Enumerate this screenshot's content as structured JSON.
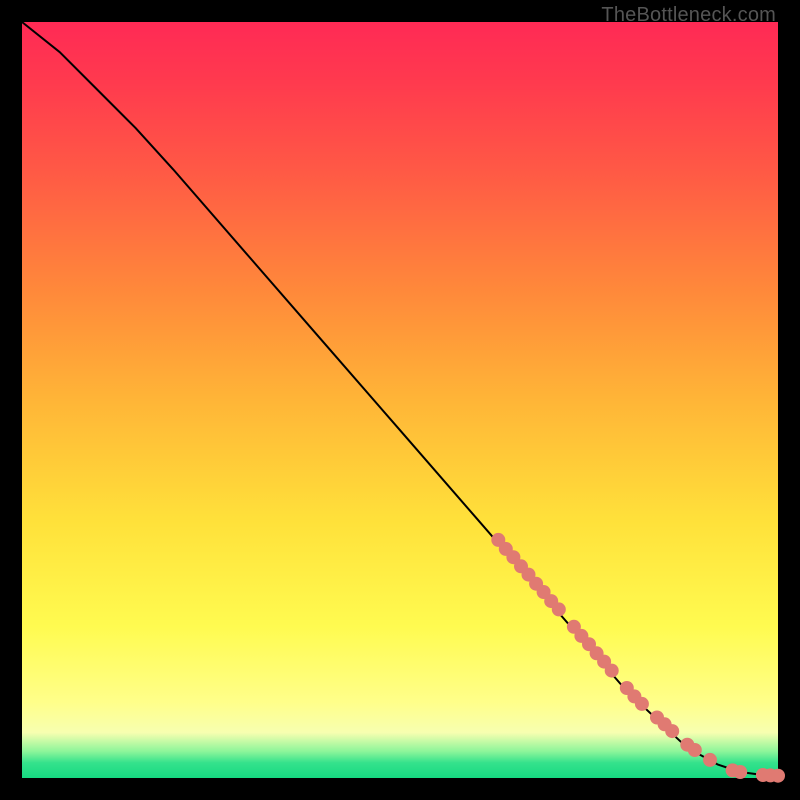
{
  "watermark": "TheBottleneck.com",
  "chart_data": {
    "type": "line",
    "title": "",
    "xlabel": "",
    "ylabel": "",
    "xlim": [
      0,
      100
    ],
    "ylim": [
      0,
      100
    ],
    "grid": false,
    "series": [
      {
        "name": "curve",
        "x": [
          0,
          5,
          10,
          15,
          20,
          30,
          40,
          50,
          60,
          70,
          80,
          88,
          92,
          95,
          98,
          100
        ],
        "y": [
          100,
          96,
          91,
          86,
          80.5,
          69,
          57.5,
          46,
          34.5,
          23,
          11.5,
          4,
          1.8,
          0.8,
          0.4,
          0.3
        ]
      }
    ],
    "marker_segments": {
      "name": "highlighted-points",
      "color": "#e07a72",
      "points": [
        [
          63,
          31.5
        ],
        [
          64,
          30.3
        ],
        [
          65,
          29.2
        ],
        [
          66,
          28.0
        ],
        [
          67,
          26.9
        ],
        [
          68,
          25.7
        ],
        [
          69,
          24.6
        ],
        [
          70,
          23.4
        ],
        [
          71,
          22.3
        ],
        [
          73,
          20.0
        ],
        [
          74,
          18.8
        ],
        [
          75,
          17.7
        ],
        [
          76,
          16.5
        ],
        [
          77,
          15.4
        ],
        [
          78,
          14.2
        ],
        [
          80,
          11.9
        ],
        [
          81,
          10.8
        ],
        [
          82,
          9.8
        ],
        [
          84,
          8.0
        ],
        [
          85,
          7.1
        ],
        [
          86,
          6.2
        ],
        [
          88,
          4.4
        ],
        [
          89,
          3.7
        ],
        [
          91,
          2.4
        ],
        [
          94,
          1.0
        ],
        [
          95,
          0.8
        ],
        [
          98,
          0.4
        ],
        [
          99,
          0.35
        ],
        [
          100,
          0.3
        ]
      ]
    }
  }
}
